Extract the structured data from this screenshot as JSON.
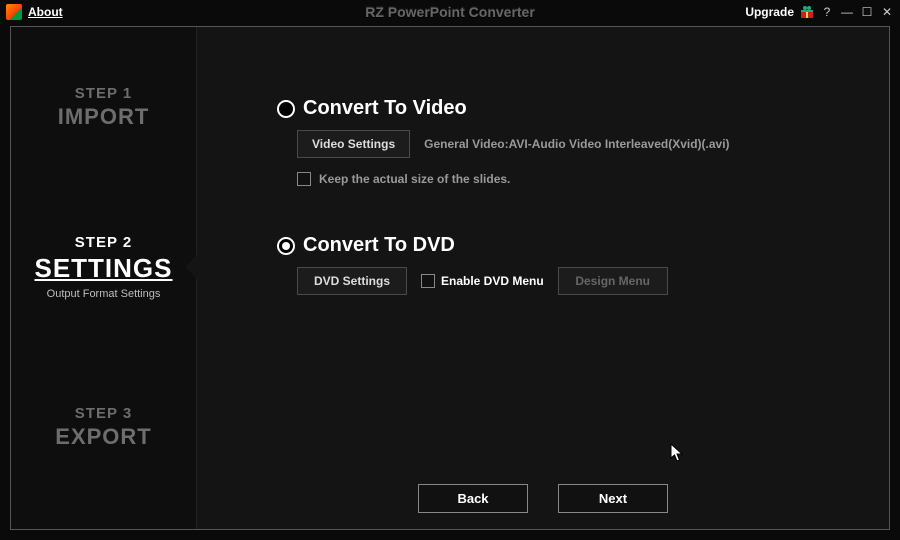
{
  "titlebar": {
    "about": "About",
    "app_title": "RZ PowerPoint Converter",
    "upgrade": "Upgrade"
  },
  "steps": [
    {
      "name": "STEP 1",
      "title": "IMPORT",
      "sub": ""
    },
    {
      "name": "STEP 2",
      "title": "SETTINGS",
      "sub": "Output Format Settings"
    },
    {
      "name": "STEP 3",
      "title": "EXPORT",
      "sub": ""
    }
  ],
  "active_step_index": 1,
  "options": {
    "video": {
      "label": "Convert To Video",
      "selected": false,
      "settings_btn": "Video Settings",
      "info": "General Video:AVI-Audio Video Interleaved(Xvid)(.avi)",
      "keep_size_label": "Keep the actual size of the slides.",
      "keep_size_checked": false
    },
    "dvd": {
      "label": "Convert To DVD",
      "selected": true,
      "settings_btn": "DVD Settings",
      "enable_menu_label": "Enable DVD Menu",
      "enable_menu_checked": false,
      "design_btn": "Design Menu"
    }
  },
  "nav": {
    "back": "Back",
    "next": "Next"
  }
}
